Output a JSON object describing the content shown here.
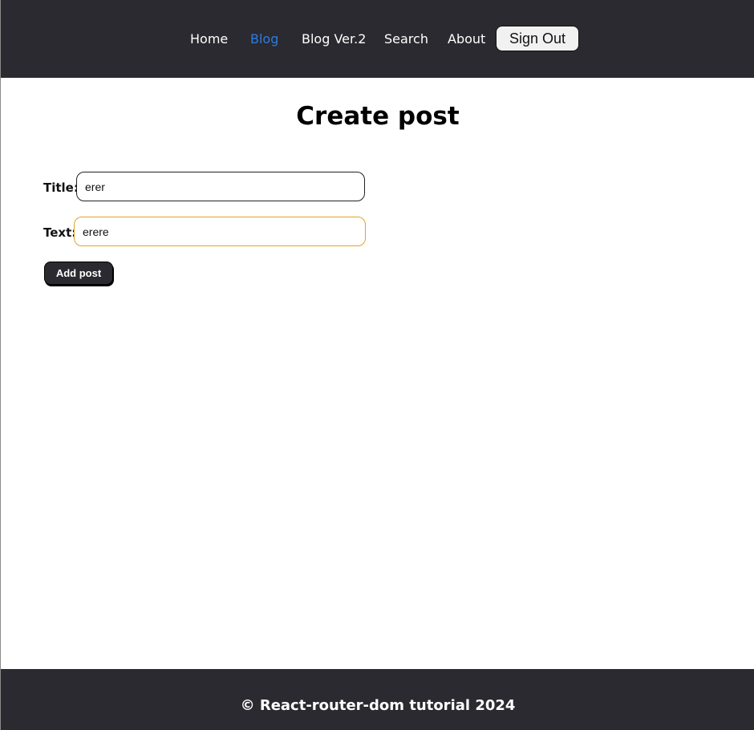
{
  "nav": {
    "items": [
      {
        "label": "Home",
        "active": false
      },
      {
        "label": "Blog",
        "active": true
      },
      {
        "label": "Blog Ver.2",
        "active": false
      },
      {
        "label": "Search",
        "active": false
      },
      {
        "label": "About",
        "active": false
      }
    ],
    "sign_out_label": "Sign Out"
  },
  "main": {
    "title": "Create post",
    "form": {
      "title_label": "Title:",
      "title_value": "erer",
      "text_label": "Text:",
      "text_value": "erere",
      "submit_label": "Add post"
    }
  },
  "footer": {
    "text": "© React-router-dom tutorial 2024"
  },
  "colors": {
    "header_bg": "#2b2a30",
    "active_link": "#2c7ce0",
    "focus_border": "#e2a32c"
  }
}
